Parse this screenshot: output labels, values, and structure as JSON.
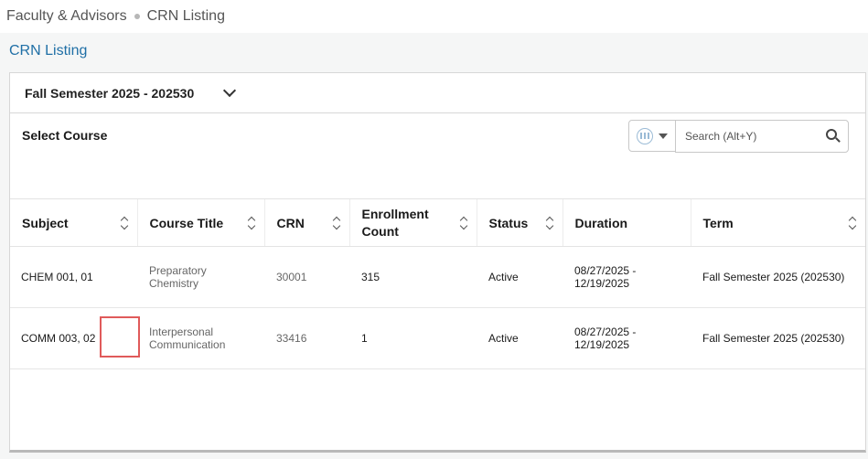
{
  "breadcrumb": {
    "parent": "Faculty & Advisors",
    "current": "CRN Listing"
  },
  "page_title": "CRN Listing",
  "term_selector": {
    "value": "Fall Semester 2025 - 202530"
  },
  "select_course_label": "Select Course",
  "search": {
    "placeholder": "Search (Alt+Y)"
  },
  "table": {
    "headers": [
      "Subject",
      "Course Title",
      "CRN",
      "Enrollment Count",
      "Status",
      "Duration",
      "Term"
    ],
    "rows": [
      {
        "subject": "CHEM 001, 01",
        "title": "Preparatory Chemistry",
        "crn": "30001",
        "enrollment": "315",
        "status": "Active",
        "duration": "08/27/2025 - 12/19/2025",
        "term": "Fall Semester 2025 (202530)"
      },
      {
        "subject": "COMM 003, 02",
        "title": "Interpersonal Communication",
        "crn": "33416",
        "enrollment": "1",
        "status": "Active",
        "duration": "08/27/2025 - 12/19/2025",
        "term": "Fall Semester 2025 (202530)"
      }
    ]
  },
  "icons": {
    "columns": "columns-icon",
    "search": "search-icon",
    "chevron": "chevron-down-icon",
    "sort": "sort-icon"
  }
}
